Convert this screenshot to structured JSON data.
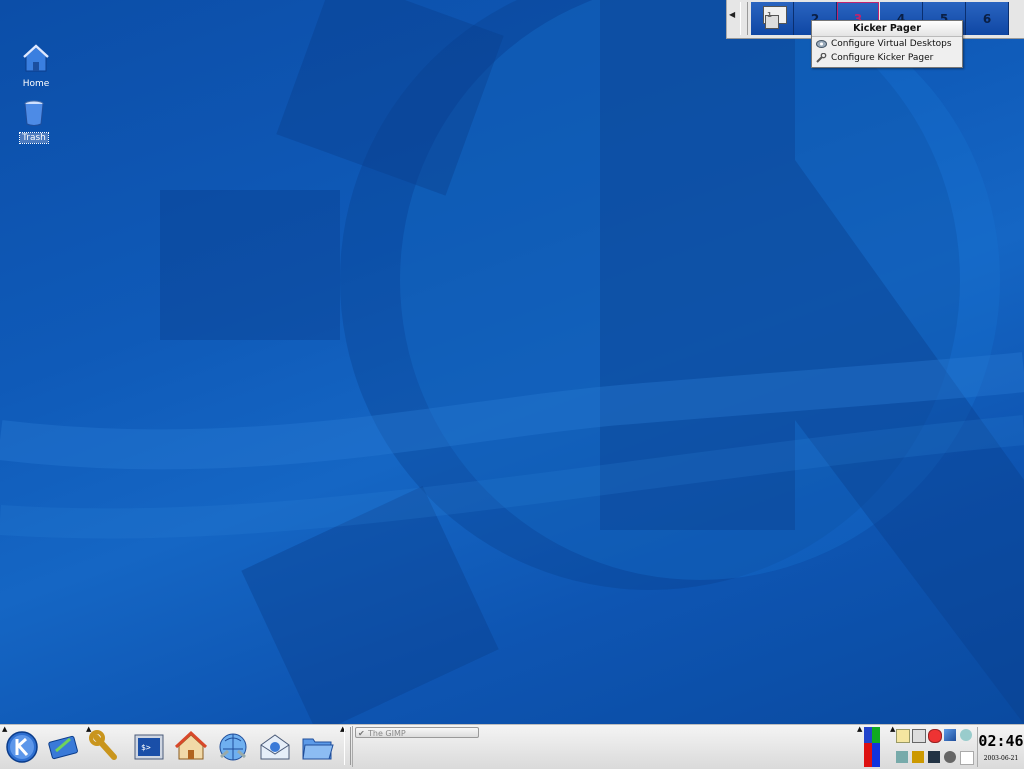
{
  "desktop": {
    "icons": [
      {
        "label": "Home",
        "icon": "home-folder-icon"
      },
      {
        "label": "Trash",
        "icon": "trash-icon"
      }
    ]
  },
  "pager": {
    "desktops": [
      "1",
      "2",
      "3",
      "4",
      "5",
      "6"
    ],
    "active_desktop": "3",
    "active_color": "#c0246e"
  },
  "context_menu": {
    "title": "Kicker Pager",
    "items": [
      {
        "label": "Configure Virtual Desktops",
        "icon": "configure-icon"
      },
      {
        "label": "Configure Kicker Pager",
        "icon": "wrench-icon"
      }
    ]
  },
  "panel": {
    "launchers": [
      {
        "name": "kde-menu",
        "icon": "kde-k-icon"
      },
      {
        "name": "kcontrol",
        "icon": "control-center-icon"
      },
      {
        "name": "tools",
        "icon": "wrench-icon"
      },
      {
        "name": "konsole",
        "icon": "terminal-icon"
      },
      {
        "name": "home",
        "icon": "home-icon"
      },
      {
        "name": "konqueror",
        "icon": "konqueror-icon"
      },
      {
        "name": "kmail",
        "icon": "mail-icon"
      },
      {
        "name": "file-manager",
        "icon": "folder-icon"
      }
    ],
    "taskbar": {
      "entries": [
        {
          "label": "The GIMP"
        }
      ]
    },
    "clock": {
      "time": "02:46",
      "date": "2003-06-21"
    }
  },
  "colors": {
    "desktop_blue": "#0f5ab8",
    "panel_gray": "#e6e6e6"
  }
}
